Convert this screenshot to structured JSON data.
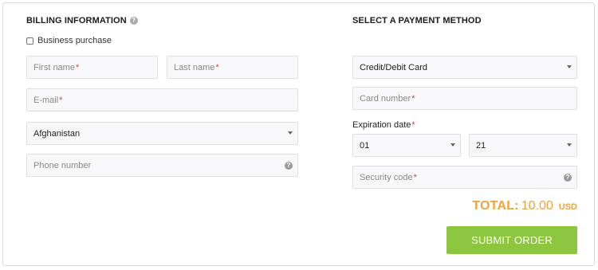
{
  "billing": {
    "heading": "BILLING INFORMATION",
    "business_purchase": "Business purchase",
    "first_name": "First name",
    "last_name": "Last name",
    "email": "E-mail",
    "country": "Afghanistan",
    "phone": "Phone number"
  },
  "payment": {
    "heading": "SELECT A PAYMENT METHOD",
    "method": "Credit/Debit Card",
    "card_number": "Card number",
    "expiration_label": "Expiration date",
    "exp_month": "01",
    "exp_year": "21",
    "security_code": "Security code"
  },
  "total": {
    "label": "TOTAL:",
    "value": "10.00",
    "currency": "USD"
  },
  "submit_label": "SUBMIT ORDER",
  "required_mark": "*",
  "help_glyph": "?",
  "colors": {
    "accent_green": "#8cc63e",
    "total_orange": "#f0a13a",
    "required_red": "#d0453a"
  }
}
